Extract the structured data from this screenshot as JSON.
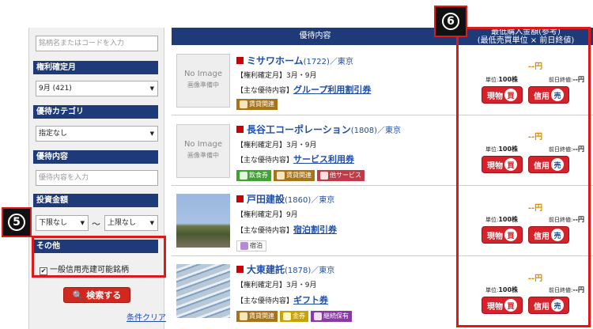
{
  "sidebar": {
    "search_placeholder": "銘柄名またはコードを入力",
    "rights_month_header": "権利確定月",
    "rights_month_value": "9月 (421)",
    "category_header": "優待カテゴリ",
    "category_value": "指定なし",
    "benefit_header": "優待内容",
    "benefit_placeholder": "優待内容を入力",
    "investment_header": "投資金額",
    "min_value": "下限なし",
    "tilde": "〜",
    "max_value": "上限なし",
    "other_header": "その他",
    "margin_checkbox_label": "一般信用売建可能銘柄",
    "search_button": "検索する",
    "clear_link": "条件クリア"
  },
  "badges": {
    "five": "5",
    "six": "6"
  },
  "table": {
    "header_benefit": "優待内容",
    "header_price_line1": "最低購入金額(参考)",
    "header_price_line2": "(最低売買単位 × 前日終値)",
    "no_image": "No Image",
    "no_image_sub": "画像準備中",
    "rights_label": "【権利確定月】",
    "main_benefit_label": "【主な優待内容】",
    "unit_label": "単位:",
    "prev_close_label": "前日終値:",
    "spot_label": "現物",
    "spot_char": "買",
    "margin_label": "信用",
    "margin_char": "売",
    "rows": [
      {
        "name": "ミサワホーム",
        "meta": "(1722)／東京",
        "months": "3月・9月",
        "benefit": "グループ利用割引券",
        "tags": [
          "賃貸関連"
        ],
        "price": "--円",
        "unit": "100株",
        "prev": "--円"
      },
      {
        "name": "長谷工コーポレーション",
        "meta": "(1808)／東京",
        "months": "3月・9月",
        "benefit": "サービス利用券",
        "tags": [
          "飲食券",
          "賃貸関連",
          "他サービス"
        ],
        "price": "--円",
        "unit": "100株",
        "prev": "--円"
      },
      {
        "name": "戸田建設",
        "meta": "(1860)／東京",
        "months": "9月",
        "benefit": "宿泊割引券",
        "tags": [
          "宿泊"
        ],
        "price": "--円",
        "unit": "100株",
        "prev": "--円"
      },
      {
        "name": "大東建託",
        "meta": "(1878)／東京",
        "months": "3月・9月",
        "benefit": "ギフト券",
        "tags": [
          "賃貸関連",
          "金券",
          "継続保有"
        ],
        "price": "--円",
        "unit": "100株",
        "prev": "--円"
      }
    ]
  }
}
